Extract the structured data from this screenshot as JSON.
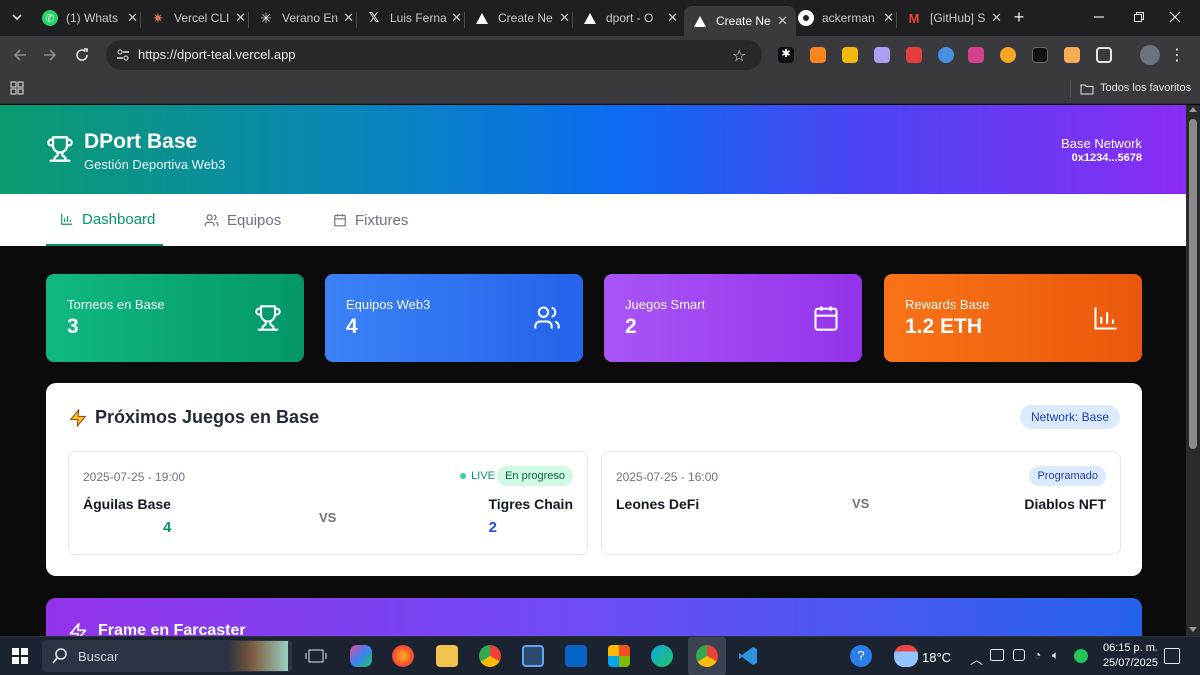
{
  "browser": {
    "tabs": [
      {
        "label": "(1) Whats",
        "icon": "whatsapp-icon",
        "color": "#25d366"
      },
      {
        "label": "Vercel CLI",
        "icon": "claude-icon",
        "color": "#d97757"
      },
      {
        "label": "Verano En",
        "icon": "perplexity-icon",
        "color": "#e5e7eb"
      },
      {
        "label": "Luis Ferna",
        "icon": "x-icon",
        "color": "#ffffff"
      },
      {
        "label": "Create Ne",
        "icon": "vercel-icon",
        "color": "#ffffff"
      },
      {
        "label": "dport - O",
        "icon": "vercel-icon",
        "color": "#ffffff"
      },
      {
        "label": "Create Ne",
        "icon": "vercel-icon",
        "color": "#ffffff",
        "active": true
      },
      {
        "label": "ackerman",
        "icon": "github-icon",
        "color": "#ffffff"
      },
      {
        "label": "[GitHub] S",
        "icon": "gmail-icon",
        "color": "#ea4335"
      }
    ],
    "url": "https://dport-teal.vercel.app",
    "bookmarks_label": "Todos los favoritos"
  },
  "header": {
    "title": "DPort Base",
    "subtitle": "Gestión Deportiva Web3",
    "network_name": "Base Network",
    "wallet": "0x1234...5678"
  },
  "nav": {
    "tabs": [
      {
        "label": "Dashboard",
        "icon": "bar-chart-icon",
        "active": true
      },
      {
        "label": "Equipos",
        "icon": "users-icon"
      },
      {
        "label": "Fixtures",
        "icon": "calendar-icon"
      }
    ]
  },
  "stats": [
    {
      "label": "Torneos en Base",
      "value": "3",
      "icon": "trophy-icon",
      "colors": [
        "#10b981",
        "#059669"
      ]
    },
    {
      "label": "Equipos Web3",
      "value": "4",
      "icon": "users-icon",
      "colors": [
        "#3b82f6",
        "#2563eb"
      ]
    },
    {
      "label": "Juegos Smart",
      "value": "2",
      "icon": "calendar-icon",
      "colors": [
        "#a855f7",
        "#9333ea"
      ]
    },
    {
      "label": "Rewards Base",
      "value": "1.2 ETH",
      "icon": "bar-chart-icon",
      "colors": [
        "#f97316",
        "#ea580c"
      ]
    }
  ],
  "games": {
    "title": "Próximos Juegos en Base",
    "network_badge": "Network: Base",
    "vs_label": "VS",
    "matches": [
      {
        "date": "2025-07-25 - 19:00",
        "home": "Águilas Base",
        "away": "Tigres Chain",
        "home_score": "4",
        "away_score": "2",
        "live_label": "LIVE",
        "status": "En progreso"
      },
      {
        "date": "2025-07-25 - 16:00",
        "home": "Leones DeFi",
        "away": "Diablos NFT",
        "status": "Programado"
      }
    ]
  },
  "frame": {
    "title": "Frame en Farcaster"
  },
  "taskbar": {
    "search_label": "Buscar",
    "weather": "18°C",
    "time": "06:15 p. m.",
    "date": "25/07/2025"
  }
}
